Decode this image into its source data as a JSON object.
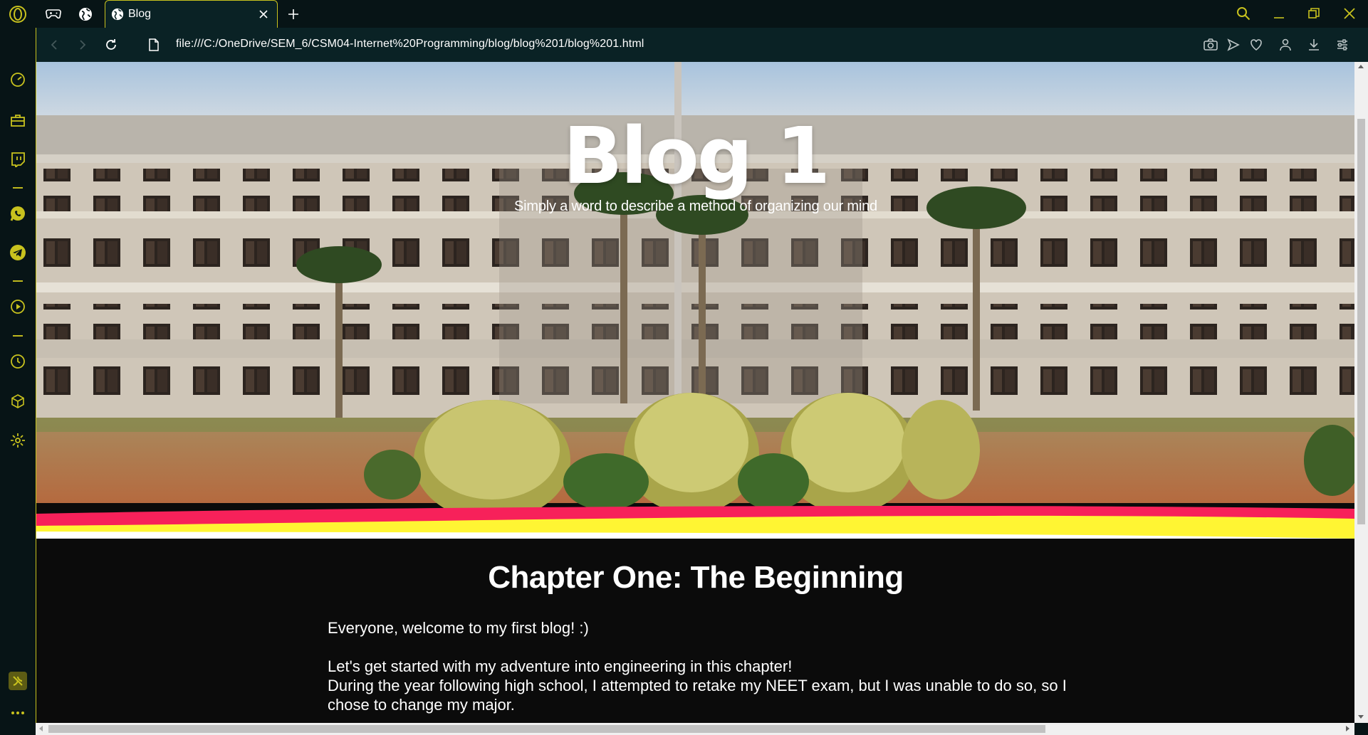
{
  "browser": {
    "tab": {
      "title": "Blog"
    },
    "address": {
      "url": "file:///C:/OneDrive/SEM_6/CSM04-Internet%20Programming/blog/blog%201/blog%201.html"
    },
    "accent_color": "#c8c21e",
    "chrome_background": "#071416",
    "toolbar_background": "#0a2225",
    "icons": {
      "tabstrip": [
        "opera-logo-icon",
        "gamepad-icon",
        "globe-icon",
        "new-tab-plus-icon"
      ],
      "window": [
        "search-icon",
        "minimize-icon",
        "restore-icon",
        "close-window-icon"
      ],
      "nav": [
        "back-arrow-icon",
        "forward-arrow-icon",
        "reload-icon",
        "file-icon"
      ],
      "tools": [
        "camera-icon",
        "send-icon",
        "heart-icon",
        "account-icon",
        "download-icon",
        "easy-setup-icon"
      ],
      "sidebar": [
        "speed-dial-icon",
        "briefcase-icon",
        "twitch-icon",
        "whatsapp-icon",
        "telegram-icon",
        "player-icon",
        "history-icon",
        "cube-icon",
        "settings-icon",
        "aria-icon",
        "more-icon"
      ]
    }
  },
  "page": {
    "hero": {
      "title": "Blog 1",
      "subtitle": "Simply a word to describe a method of organizing our mind",
      "wave_colors": [
        "#f7215a",
        "#fff533"
      ]
    },
    "article": {
      "heading": "Chapter One: The Beginning",
      "paragraphs": [
        "Everyone, welcome to my first blog! :)",
        "Let's get started with my adventure into engineering in this chapter!",
        "During the year following high school, I attempted to retake my NEET exam, but I was unable to do so, so I chose to change my major."
      ]
    }
  }
}
